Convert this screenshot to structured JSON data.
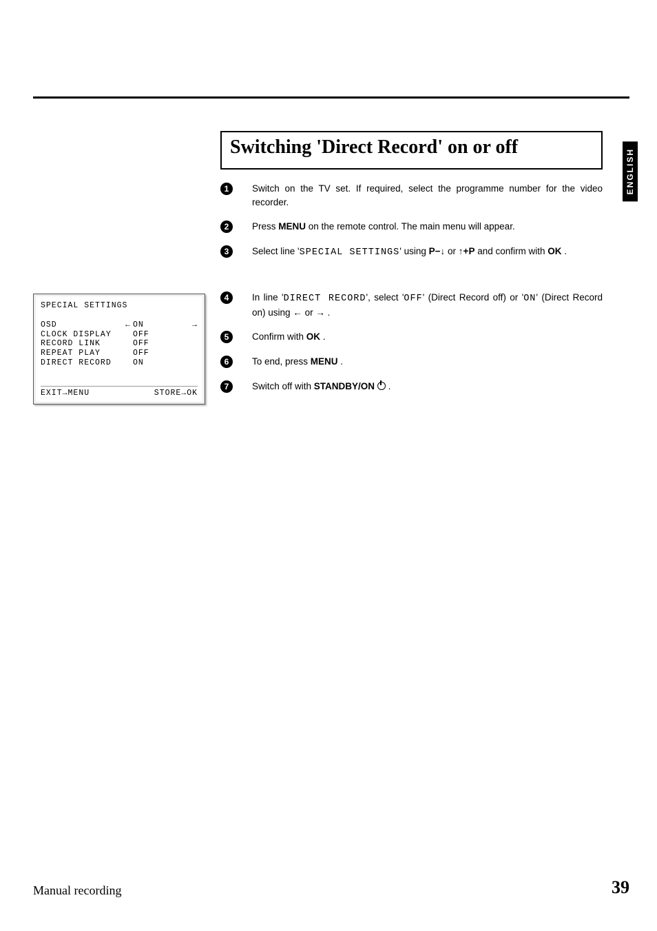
{
  "language_tab": "ENGLISH",
  "heading": "Switching 'Direct Record' on or off",
  "steps": {
    "s1_a": "Switch on the TV set. If required, select the programme number for the video recorder.",
    "s2_a": "Press ",
    "s2_btn": "MENU",
    "s2_b": " on the remote control. The main menu will appear.",
    "s3_a": "Select line '",
    "s3_mono": "SPECIAL SETTINGS",
    "s3_b": "' using ",
    "s3_key1a": "P",
    "s3_key1b": "−",
    "s3_arrow_down": "↓",
    "s3_or": " or ",
    "s3_arrow_up": "↑",
    "s3_key2a": "+",
    "s3_key2b": "P",
    "s3_c": " and confirm with ",
    "s3_ok": "OK",
    "s3_end": " .",
    "s4_a": "In line '",
    "s4_mono": "DIRECT RECORD",
    "s4_b": "', select '",
    "s4_off": "OFF",
    "s4_c": "' (Direct Record off) or '",
    "s4_on": "ON",
    "s4_d": "' (Direct Record on) using ",
    "s4_left": "←",
    "s4_or": " or ",
    "s4_right": "→",
    "s4_end": " .",
    "s5_a": "Confirm with ",
    "s5_ok": "OK",
    "s5_end": " .",
    "s6_a": "To end, press ",
    "s6_btn": "MENU",
    "s6_end": " .",
    "s7_a": "Switch off with ",
    "s7_btn": "STANDBY/ON",
    "s7_end": " ."
  },
  "osd": {
    "title": "SPECIAL SETTINGS",
    "items": [
      {
        "label": "OSD",
        "value": "ON",
        "sel_left": "←",
        "sel_right": "→"
      },
      {
        "label": "CLOCK DISPLAY",
        "value": "OFF",
        "sel_left": "",
        "sel_right": ""
      },
      {
        "label": "RECORD LINK",
        "value": "OFF",
        "sel_left": "",
        "sel_right": ""
      },
      {
        "label": "REPEAT PLAY",
        "value": "OFF",
        "sel_left": "",
        "sel_right": ""
      },
      {
        "label": "DIRECT RECORD",
        "value": "ON",
        "sel_left": "",
        "sel_right": ""
      }
    ],
    "exit_a": "EXIT",
    "exit_arrow": "→",
    "exit_b": "MENU",
    "store_a": "STORE",
    "store_arrow": "→",
    "store_b": "OK"
  },
  "footer": {
    "section": "Manual recording",
    "page": "39"
  }
}
